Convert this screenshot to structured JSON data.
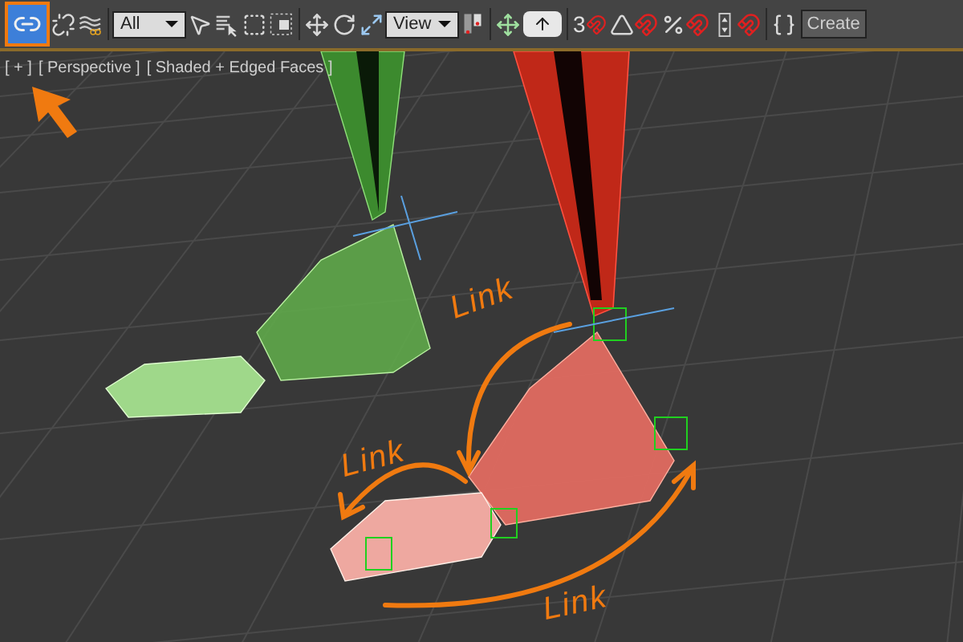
{
  "toolbar": {
    "link_tool": {
      "selected": true
    },
    "selection_filter": "All",
    "reference_coordinate": "View",
    "snap_toggle_label": "3",
    "create_button": "Create"
  },
  "viewport": {
    "menu_label": "[ + ]",
    "view_label": "[ Perspective ]",
    "shading_label": "[ Shaded + Edged Faces ]",
    "annotations": [
      {
        "text": "Link"
      },
      {
        "text": "Link"
      },
      {
        "text": "Link"
      }
    ]
  }
}
